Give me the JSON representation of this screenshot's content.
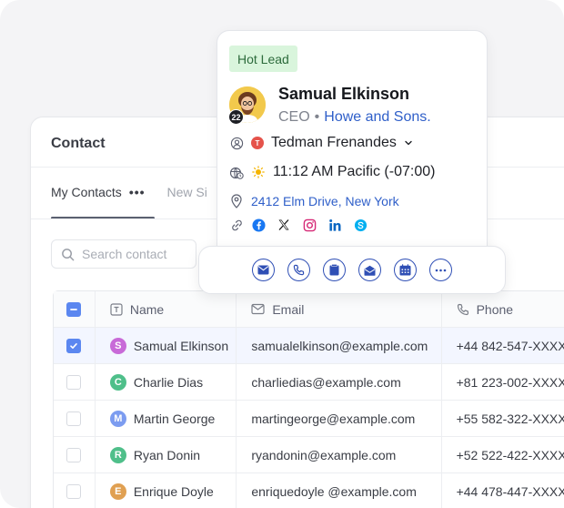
{
  "contact_card": {
    "title": "Contact",
    "tabs": [
      {
        "label": "My Contacts",
        "more": "•••"
      },
      {
        "label": "New Si"
      }
    ],
    "search": {
      "placeholder": "Search contact"
    },
    "table": {
      "headers": {
        "name": "Name",
        "email": "Email",
        "phone": "Phone"
      },
      "rows": [
        {
          "initial": "S",
          "color": "#c86ad8",
          "name": "Samual Elkinson",
          "email": "samualelkinson@example.com",
          "phone": "+44 842-547-XXXX",
          "checked": true
        },
        {
          "initial": "C",
          "color": "#4fbf8a",
          "name": "Charlie Dias",
          "email": "charliedias@example.com",
          "phone": "+81 223-002-XXXX",
          "checked": false
        },
        {
          "initial": "M",
          "color": "#7c9cf0",
          "name": "Martin George",
          "email": "martingeorge@example.com",
          "phone": "+55 582-322-XXXX",
          "checked": false
        },
        {
          "initial": "R",
          "color": "#4fbf8a",
          "name": "Ryan Donin",
          "email": "ryandonin@example.com",
          "phone": "+52 522-422-XXXX",
          "checked": false
        },
        {
          "initial": "E",
          "color": "#e0a052",
          "name": "Enrique Doyle",
          "email": "enriquedoyle @example.com",
          "phone": "+44 478-447-XXXX",
          "checked": false
        }
      ]
    }
  },
  "popover": {
    "tag": "Hot Lead",
    "name": "Samual Elkinson",
    "role": "CEO",
    "separator": "•",
    "company": "Howe and Sons.",
    "avatar_badge": "22",
    "owner": {
      "initial": "T",
      "name": "Tedman Frenandes"
    },
    "time": "11:12 AM Pacific (-07:00)",
    "address": "2412 Elm Drive, New York",
    "socials": [
      {
        "icon": "facebook-icon",
        "glyph": "f",
        "color": "#1877f2"
      },
      {
        "icon": "x-icon",
        "glyph": "X",
        "color": "#111111"
      },
      {
        "icon": "instagram-icon",
        "glyph": "◎",
        "color": "#d62976"
      },
      {
        "icon": "linkedin-icon",
        "glyph": "in",
        "color": "#0a66c2"
      },
      {
        "icon": "skype-icon",
        "glyph": "S",
        "color": "#00aff0"
      }
    ]
  },
  "actions": [
    {
      "name": "email-action-button",
      "icon": "envelope-icon"
    },
    {
      "name": "call-action-button",
      "icon": "phone-icon"
    },
    {
      "name": "note-action-button",
      "icon": "note-icon"
    },
    {
      "name": "message-action-button",
      "icon": "mail-open-icon"
    },
    {
      "name": "schedule-action-button",
      "icon": "calendar-icon"
    },
    {
      "name": "more-action-button",
      "icon": "more-icon"
    }
  ],
  "colors": {
    "accent": "#2f4fb5",
    "link": "#2f5fc9",
    "checkbox": "#5b87f0",
    "tag_bg": "#d9f5dc"
  }
}
